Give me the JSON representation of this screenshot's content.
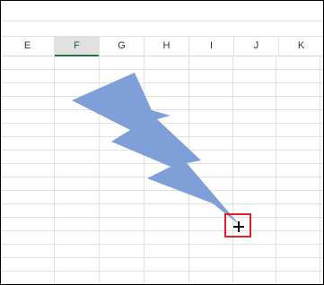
{
  "sheet": {
    "columns": [
      "E",
      "F",
      "G",
      "H",
      "I",
      "J",
      "K"
    ],
    "selected_column": "F"
  },
  "colors": {
    "shape_fill": "#7f9fd9",
    "grid": "#e1e1e1",
    "selection_accent": "#217346",
    "highlight_box": "#e0202a"
  },
  "icons": {
    "cursor": "crosshair-icon"
  }
}
